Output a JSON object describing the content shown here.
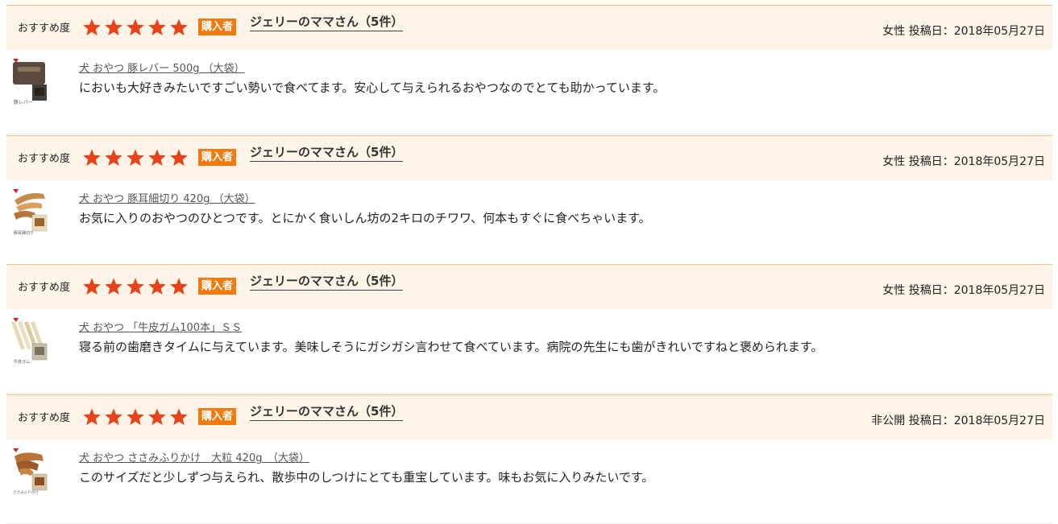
{
  "reviews": [
    {
      "rec_label": "おすすめ度",
      "rating": 5,
      "buyer_badge": "購入者",
      "reviewer": "ジェリーのママさん（5件）",
      "gender": "女性",
      "posted": "投稿日：2018年05月27日",
      "product": "犬 おやつ 豚レバー 500g （大袋）",
      "comment": "においも大好きみたいですごい勢いで食べてます。安心して与えられるおやつなのでとても助かっています。",
      "thumb_label": "豚レバー",
      "thumb_color": "#5b4a3e"
    },
    {
      "rec_label": "おすすめ度",
      "rating": 5,
      "buyer_badge": "購入者",
      "reviewer": "ジェリーのママさん（5件）",
      "gender": "女性",
      "posted": "投稿日：2018年05月27日",
      "product": "犬 おやつ 豚耳細切り 420g （大袋）",
      "comment": "お気に入りのおやつのひとつです。とにかく食いしん坊の2キロのチワワ、何本もすぐに食べちゃいます。",
      "thumb_label": "豚耳細切り",
      "thumb_color": "#c98a4a"
    },
    {
      "rec_label": "おすすめ度",
      "rating": 5,
      "buyer_badge": "購入者",
      "reviewer": "ジェリーのママさん（5件）",
      "gender": "女性",
      "posted": "投稿日：2018年05月27日",
      "product": "犬 おやつ 「牛皮ガム100本」ＳＳ",
      "comment": "寝る前の歯磨きタイムに与えています。美味しそうにガシガシ言わせて食べています。病院の先生にも歯がきれいですねと褒められます。",
      "thumb_label": "牛皮ガム",
      "thumb_color": "#e7d9b5"
    },
    {
      "rec_label": "おすすめ度",
      "rating": 5,
      "buyer_badge": "購入者",
      "reviewer": "ジェリーのママさん（5件）",
      "gender": "非公開",
      "posted": "投稿日：2018年05月27日",
      "product": "犬 おやつ ささみふりかけ　大粒 420g　（大袋）",
      "comment": "このサイズだと少しずつ与えられ、散歩中のしつけにとても重宝しています。味もお気に入りみたいです。",
      "thumb_label": "ささみふりかけ",
      "thumb_color": "#b87338"
    }
  ],
  "colors": {
    "header_bg": "#fdf3e6",
    "header_border": "#f0c27a",
    "star": "#e8421a",
    "badge": "#f07a0e"
  }
}
